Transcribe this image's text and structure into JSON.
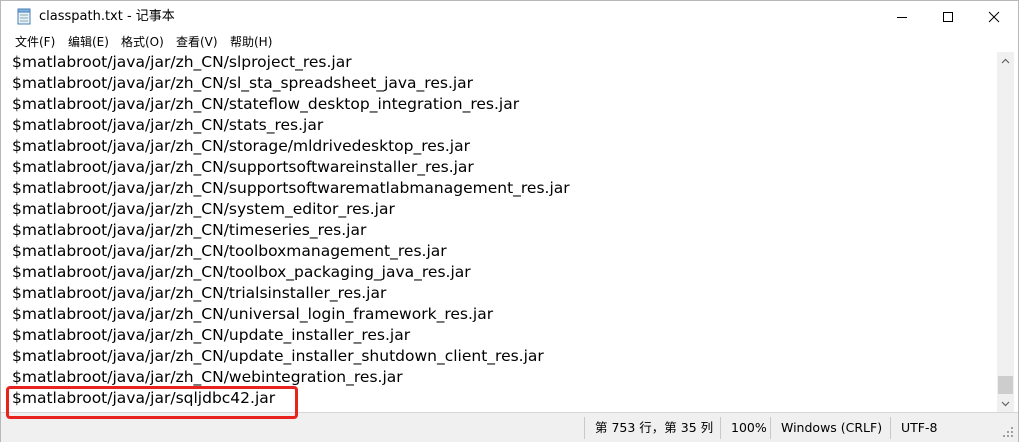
{
  "window": {
    "title": "classpath.txt - 记事本",
    "controls": {
      "minimize_icon": "minimize-icon",
      "maximize_icon": "maximize-icon",
      "close_icon": "close-icon"
    }
  },
  "menu": {
    "file": "文件(F)",
    "edit": "编辑(E)",
    "format": "格式(O)",
    "view": "查看(V)",
    "help": "帮助(H)"
  },
  "editor": {
    "lines": [
      "$matlabroot/java/jar/zh_CN/slproject_res.jar",
      "$matlabroot/java/jar/zh_CN/sl_sta_spreadsheet_java_res.jar",
      "$matlabroot/java/jar/zh_CN/stateflow_desktop_integration_res.jar",
      "$matlabroot/java/jar/zh_CN/stats_res.jar",
      "$matlabroot/java/jar/zh_CN/storage/mldrivedesktop_res.jar",
      "$matlabroot/java/jar/zh_CN/supportsoftwareinstaller_res.jar",
      "$matlabroot/java/jar/zh_CN/supportsoftwarematlabmanagement_res.jar",
      "$matlabroot/java/jar/zh_CN/system_editor_res.jar",
      "$matlabroot/java/jar/zh_CN/timeseries_res.jar",
      "$matlabroot/java/jar/zh_CN/toolboxmanagement_res.jar",
      "$matlabroot/java/jar/zh_CN/toolbox_packaging_java_res.jar",
      "$matlabroot/java/jar/zh_CN/trialsinstaller_res.jar",
      "$matlabroot/java/jar/zh_CN/universal_login_framework_res.jar",
      "$matlabroot/java/jar/zh_CN/update_installer_res.jar",
      "$matlabroot/java/jar/zh_CN/update_installer_shutdown_client_res.jar",
      "$matlabroot/java/jar/zh_CN/webintegration_res.jar",
      "$matlabroot/java/jar/sqljdbc42.jar"
    ]
  },
  "status": {
    "position": "第 753 行，第 35 列",
    "zoom": "100%",
    "line_ending": "Windows (CRLF)",
    "encoding": "UTF-8"
  },
  "colors": {
    "highlight": "#e8231f",
    "statusbar_bg": "#f0f0f0"
  }
}
